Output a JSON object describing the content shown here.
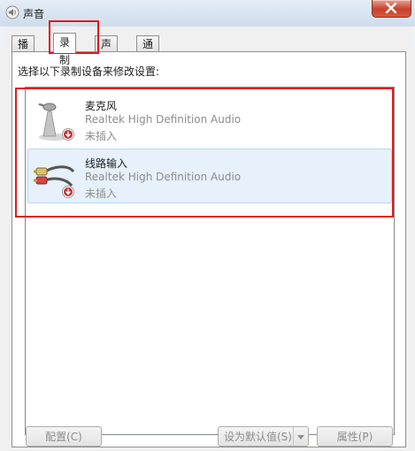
{
  "window": {
    "title": "声音"
  },
  "tabs": [
    {
      "label": "播放",
      "active": false
    },
    {
      "label": "录制",
      "active": true
    },
    {
      "label": "声音",
      "active": false
    },
    {
      "label": "通信",
      "active": false
    }
  ],
  "instruction": "选择以下录制设备来修改设置:",
  "devices": [
    {
      "name": "麦克风",
      "description": "Realtek High Definition Audio",
      "status": "未插入",
      "icon": "microphone-icon",
      "selected": false
    },
    {
      "name": "线路输入",
      "description": "Realtek High Definition Audio",
      "status": "未插入",
      "icon": "line-in-cable-icon",
      "selected": true
    }
  ],
  "buttons": {
    "configure": "配置(C)",
    "set_default": "设为默认值(S)",
    "properties": "属性(P)"
  },
  "colors": {
    "highlight": "#e01a1a",
    "selected_row": "#e6f1fb"
  }
}
